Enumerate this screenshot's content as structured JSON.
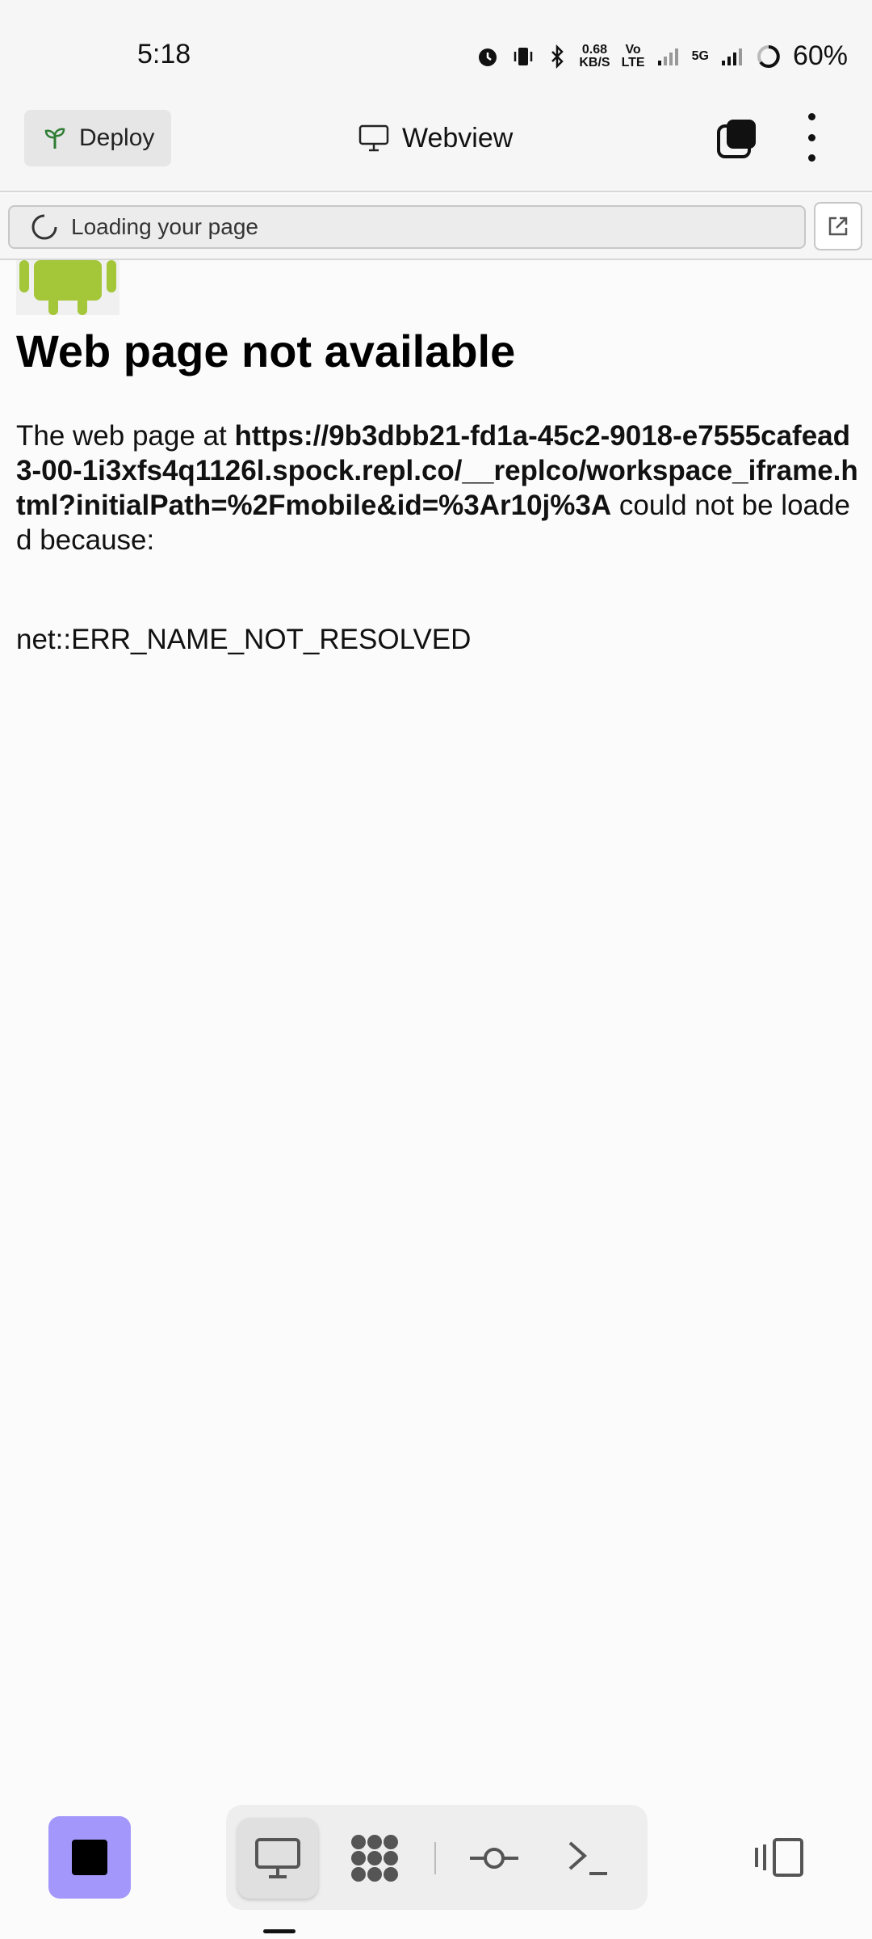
{
  "status_bar": {
    "time": "5:18",
    "data_speed_value": "0.68",
    "data_speed_unit": "KB/S",
    "volte_top": "Vo",
    "volte_bottom": "LTE",
    "network": "5G",
    "battery": "60%"
  },
  "header": {
    "deploy_label": "Deploy",
    "title": "Webview"
  },
  "loadbar": {
    "status_text": "Loading your page"
  },
  "error_page": {
    "title": "Web page not available",
    "message_prefix": "The web page at ",
    "url": "https://9b3dbb21-fd1a-45c2-9018-e7555cafead3-00-1i3xfs4q1126l.spock.repl.co/__replco/workspace_iframe.html?initialPath=%2Fmobile&id=%3Ar10j%3A",
    "message_suffix": " could not be loaded because:",
    "error_code": "net::ERR_NAME_NOT_RESOLVED"
  },
  "colors": {
    "stop_button": "#a497fb",
    "android_green": "#a4c639",
    "deploy_icon": "#2e7d32"
  },
  "icons": {
    "deploy": "sprout-icon",
    "title": "monitor-icon",
    "tabs": "tabs-icon",
    "menu": "kebab-menu-icon",
    "loading": "spinner-icon",
    "open_external": "external-link-icon",
    "stop": "stop-icon",
    "webview_tool": "monitor-icon",
    "packages_tool": "grid-dots-icon",
    "git_tool": "git-commit-icon",
    "shell_tool": "terminal-icon",
    "side_panel": "side-panel-icon"
  }
}
